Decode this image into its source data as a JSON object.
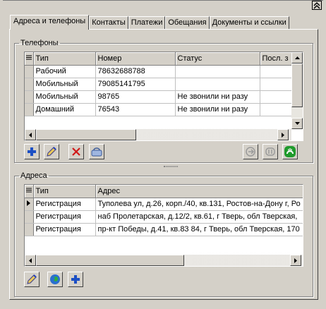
{
  "tabs": [
    {
      "label": "Адреса и телефоны",
      "active": true
    },
    {
      "label": "Контакты"
    },
    {
      "label": "Платежи"
    },
    {
      "label": "Обещания"
    },
    {
      "label": "Документы и ссылки"
    }
  ],
  "phones": {
    "legend": "Телефоны",
    "columns": [
      "Тип",
      "Номер",
      "Статус",
      "Посл. з"
    ],
    "rows": [
      {
        "type": "Рабочий",
        "number": "78632688788",
        "status": "",
        "last": ""
      },
      {
        "type": "Мобильный",
        "number": "79085141795",
        "status": "",
        "last": ""
      },
      {
        "type": "Мобильный",
        "number": "98765",
        "status": "Не звонили ни разу",
        "last": ""
      },
      {
        "type": "Домашний",
        "number": "76543",
        "status": "Не звонили ни разу",
        "last": ""
      }
    ]
  },
  "addresses": {
    "legend": "Адреса",
    "columns": [
      "Тип",
      "Адрес"
    ],
    "rows": [
      {
        "type": "Регистрация",
        "address": "Туполева ул, д.26, корп./40, кв.131, Ростов-на-Дону г, Ро"
      },
      {
        "type": "Регистрация",
        "address": "наб Пролетарская, д.12/2, кв.61, г Тверь, обл Тверская,"
      },
      {
        "type": "Регистрация",
        "address": "пр-кт Победы, д.41, кв.83 84, г Тверь, обл Тверская, 170"
      }
    ]
  },
  "icons": {
    "add": "plus-icon",
    "edit": "pencil-icon",
    "delete": "red-x-icon",
    "phone_dial": "dial-icon",
    "call_out": "call-icon",
    "call_hold": "hold-icon",
    "call_green": "green-phone-icon",
    "globe": "globe-icon",
    "collapse": "double-chevron-up-icon"
  },
  "colors": {
    "face": "#d4d0c8",
    "add_blue": "#1c4fc4",
    "delete_red": "#d01818",
    "green": "#1f9a2c"
  }
}
